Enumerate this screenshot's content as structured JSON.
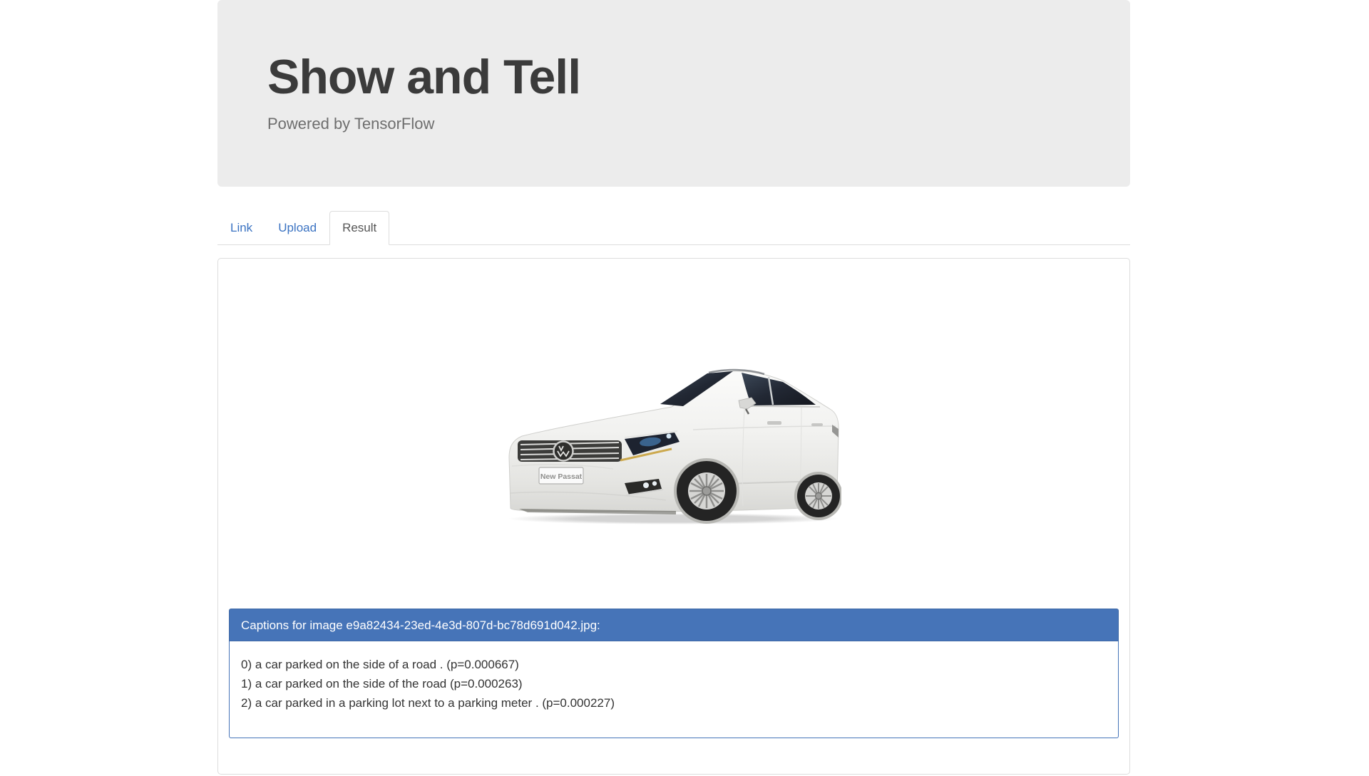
{
  "header": {
    "title": "Show and Tell",
    "subtitle": "Powered by TensorFlow"
  },
  "tabs": [
    {
      "label": "Link",
      "active": false
    },
    {
      "label": "Upload",
      "active": false
    },
    {
      "label": "Result",
      "active": true
    }
  ],
  "result": {
    "image": {
      "description": "white Volkswagen New Passat sedan, three-quarter front-left studio photo",
      "plate_text": "New Passat"
    },
    "captions_header": "Captions for image e9a82434-23ed-4e3d-807d-bc78d691d042.jpg:",
    "captions": [
      "0) a car parked on the side of a road . (p=0.000667)",
      "1) a car parked on the side of the road (p=0.000263)",
      "2) a car parked in a parking lot next to a parking meter . (p=0.000227)"
    ]
  },
  "colors": {
    "jumbotron_bg": "#ececec",
    "link_blue": "#3b73c2",
    "panel_blue": "#4674b8",
    "border_gray": "#dddddd",
    "title_text": "#3b3b3b"
  }
}
